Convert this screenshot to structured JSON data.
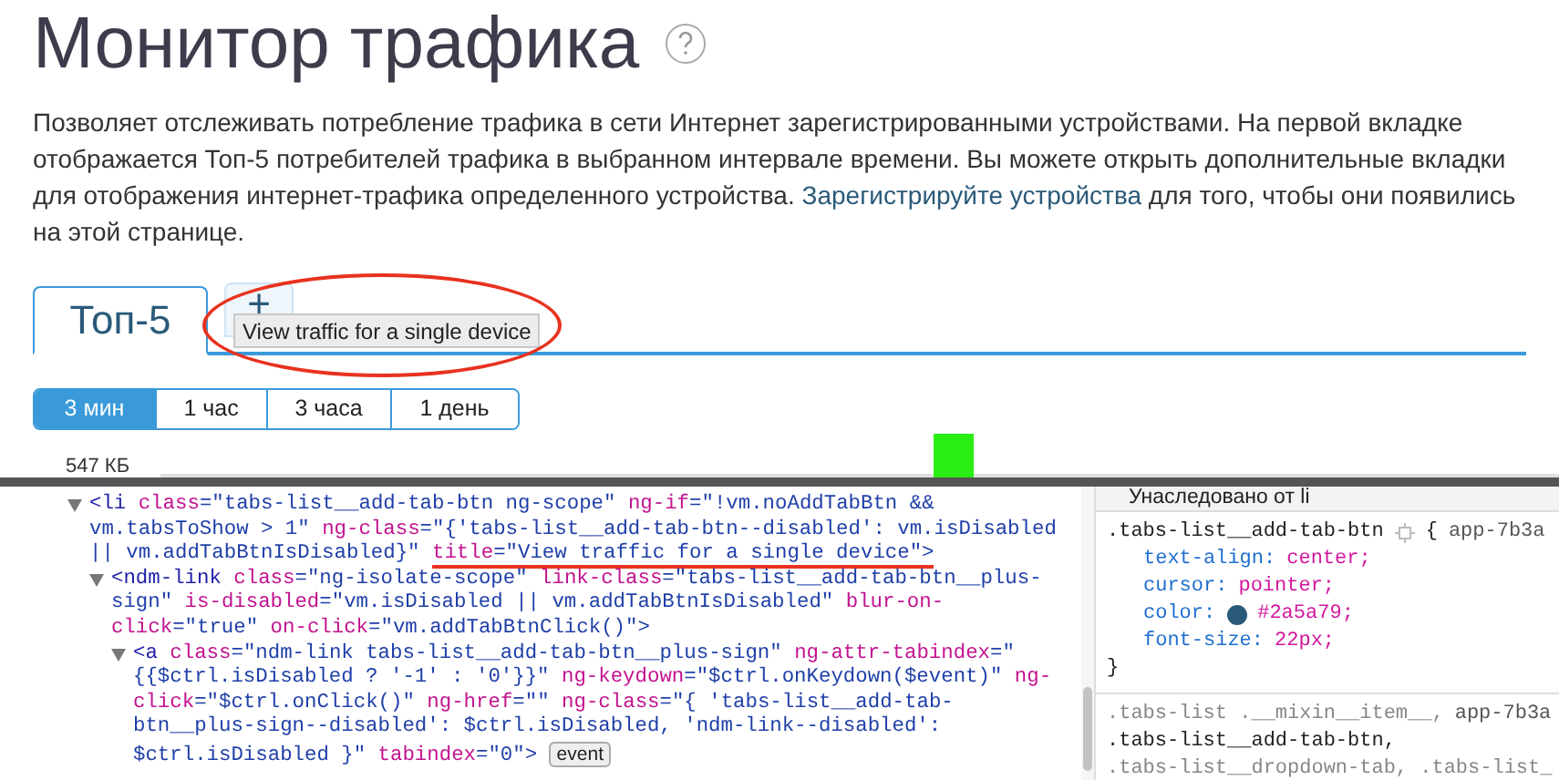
{
  "page": {
    "title": "Монитор трафика",
    "description": [
      "Позволяет отслеживать потребление трафика в сети Интернет зарегистрированными устройствами. На первой вкладке отображается Топ-5 потребителей трафика в выбранном интервале времени. Вы можете открыть дополнительные вкладки для отображения интернет-трафика определенного устройства. ",
      {
        "link": "Зарегистрируйте устройства"
      },
      " для того, чтобы они появились на этой странице."
    ],
    "tabs": [
      {
        "kind": "tab",
        "label": "Топ-5",
        "selected": true
      },
      {
        "kind": "add",
        "label": "+",
        "selected": false
      }
    ],
    "tooltip": "View traffic for a single device",
    "periods": [
      {
        "label": "3 мин",
        "selected": true
      },
      {
        "label": "1 час",
        "selected": false
      },
      {
        "label": "3 часа",
        "selected": false
      },
      {
        "label": "1 день",
        "selected": false
      }
    ],
    "chart": {
      "y_label": "547 КБ"
    }
  },
  "devtools": {
    "dom_tree": [
      {
        "expanded": true,
        "tokens": [
          {
            "kind": "tag",
            "t": "<li"
          },
          {
            "kind": "attr",
            "t": "class"
          },
          {
            "kind": "val",
            "t": "=\"tabs-list__add-tab-btn ng-scope\""
          },
          {
            "kind": "attr",
            "t": "ng-if"
          },
          {
            "kind": "val",
            "t": "=\"!vm.noAddTabBtn && vm.tabsToShow > 1\""
          },
          {
            "kind": "attr",
            "t": "ng-class"
          },
          {
            "kind": "val",
            "t": "=\"{'tabs-list__add-tab-btn--disabled': vm.isDisabled || vm.addTabBtnIsDisabled}\""
          },
          {
            "kind": "attr",
            "t": "title",
            "marked": true
          },
          {
            "kind": "val",
            "t": "=\"View traffic for a single device\">",
            "marked": true
          }
        ],
        "children": [
          {
            "expanded": true,
            "tokens": [
              {
                "kind": "tag",
                "t": "<ndm-link"
              },
              {
                "kind": "attr",
                "t": "class"
              },
              {
                "kind": "val",
                "t": "=\"ng-isolate-scope\""
              },
              {
                "kind": "attr",
                "t": "link-class"
              },
              {
                "kind": "val",
                "t": "=\"tabs-list__add-tab-btn__plus-sign\""
              },
              {
                "kind": "attr",
                "t": "is-disabled"
              },
              {
                "kind": "val",
                "t": "=\"vm.isDisabled || vm.addTabBtnIsDisabled\""
              },
              {
                "kind": "attr",
                "t": "blur-on-click"
              },
              {
                "kind": "val",
                "t": "=\"true\""
              },
              {
                "kind": "attr",
                "t": "on-click"
              },
              {
                "kind": "val",
                "t": "=\"vm.addTabBtnClick()\">"
              }
            ],
            "children": [
              {
                "expanded": true,
                "tokens": [
                  {
                    "kind": "tag",
                    "t": "<a"
                  },
                  {
                    "kind": "attr",
                    "t": "class"
                  },
                  {
                    "kind": "val",
                    "t": "=\"ndm-link tabs-list__add-tab-btn__plus-sign\""
                  },
                  {
                    "kind": "attr",
                    "t": "ng-attr-tabindex"
                  },
                  {
                    "kind": "val",
                    "t": "=\"{{$ctrl.isDisabled ? '-1' : '0'}}\""
                  },
                  {
                    "kind": "attr",
                    "t": "ng-keydown"
                  },
                  {
                    "kind": "val",
                    "t": "=\"$ctrl.onKeydown($event)\""
                  },
                  {
                    "kind": "attr",
                    "t": "ng-click"
                  },
                  {
                    "kind": "val",
                    "t": "=\"$ctrl.onClick()\""
                  },
                  {
                    "kind": "attr",
                    "t": "ng-href"
                  },
                  {
                    "kind": "val",
                    "t": "=\"\""
                  },
                  {
                    "kind": "attr",
                    "t": "ng-class"
                  },
                  {
                    "kind": "val",
                    "t": "=\"{ 'tabs-list__add-tab-btn__plus-sign--disabled': $ctrl.isDisabled, 'ndm-link--disabled': $ctrl.isDisabled }\""
                  },
                  {
                    "kind": "attr",
                    "t": "tabindex"
                  },
                  {
                    "kind": "val",
                    "t": "=\"0\">"
                  },
                  {
                    "kind": "badge",
                    "t": "event"
                  }
                ]
              }
            ]
          }
        ]
      }
    ],
    "styles": {
      "header": "Унаследовано от li",
      "rules": [
        {
          "selectors": [
            {
              "t": ".tabs-list__add-tab-btn",
              "matched": true
            }
          ],
          "brace": "{",
          "source": "app-7b3a",
          "declarations": [
            {
              "prop": "text-align:",
              "value": "center;"
            },
            {
              "prop": "cursor:",
              "value": "pointer;"
            },
            {
              "prop": "color:",
              "value": "#2a5a79;",
              "color": "#2a5a79"
            },
            {
              "prop": "font-size:",
              "value": "22px;"
            }
          ],
          "close": "}"
        },
        {
          "selectors": [
            {
              "t": ".tabs-list .__mixin__item__,",
              "matched": false
            },
            {
              "t": ".tabs-list__add-tab-btn,",
              "matched": true
            },
            {
              "t": ".tabs-list__dropdown-tab, .tabs-list_",
              "matched": false
            }
          ],
          "source": "app-7b3a"
        }
      ]
    }
  }
}
